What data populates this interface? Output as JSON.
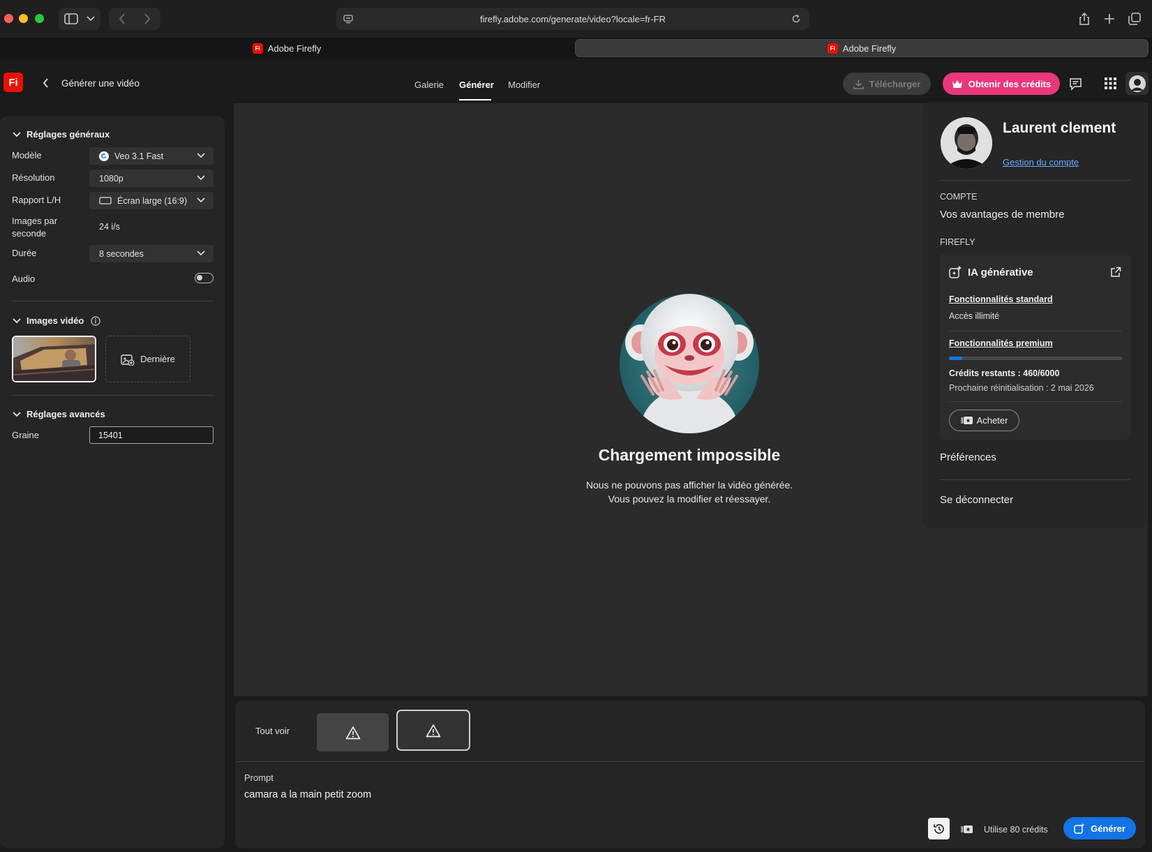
{
  "browser": {
    "url": "firefly.adobe.com/generate/video?locale=fr-FR",
    "tabs": [
      {
        "label": "Adobe Firefly",
        "favicon": "Fi"
      },
      {
        "label": "Adobe Firefly",
        "favicon": "Fi"
      }
    ]
  },
  "header": {
    "logo": "Fi",
    "back_title": "Générer une vidéo",
    "nav": [
      "Galerie",
      "Générer",
      "Modifier"
    ],
    "active_nav": "Générer",
    "download_label": "Télécharger",
    "credits_button": "Obtenir des crédits"
  },
  "settings": {
    "general_title": "Réglages généraux",
    "rows": {
      "model_label": "Modèle",
      "model_value": "Veo 3.1 Fast",
      "resolution_label": "Résolution",
      "resolution_value": "1080p",
      "ratio_label": "Rapport L/H",
      "ratio_value": "Écran large (16:9)",
      "fps_label_1": "Images par",
      "fps_label_2": "seconde",
      "fps_value": "24 i/s",
      "duration_label": "Durée",
      "duration_value": "8 secondes",
      "audio_label": "Audio"
    },
    "audio_on": false,
    "video_images_title": "Images vidéo",
    "last_label": "Dernière",
    "advanced_title": "Réglages avancés",
    "seed_label": "Graine",
    "seed_value": "15401"
  },
  "main": {
    "error_title": "Chargement impossible",
    "error_line1": "Nous ne pouvons pas afficher la vidéo générée.",
    "error_line2": "Vous pouvez la modifier et réessayer."
  },
  "bottom": {
    "see_all": "Tout voir",
    "prompt_label": "Prompt",
    "prompt_text": "camara a la main petit zoom",
    "credits_usage": "Utilise 80 crédits",
    "generate_label": "Générer"
  },
  "profile": {
    "name": "Laurent clement",
    "account_link": "Gestion du compte",
    "section_account": "COMPTE",
    "member_benefits": "Vos avantages de membre",
    "section_firefly": "FIREFLY",
    "genai_title": "IA générative",
    "standard_link": "Fonctionnalités standard",
    "standard_access": "Accès illimité",
    "premium_link": "Fonctionnalités premium",
    "credits_fraction": 0.077,
    "credits_text": "Crédits restants : 460/6000",
    "reset_text": "Prochaine réinitialisation : 2 mai 2026",
    "buy_label": "Acheter",
    "preferences": "Préférences",
    "logout": "Se déconnecter"
  },
  "colors": {
    "accent_blue": "#1473e6",
    "credits_pink": "#e9377a",
    "brand_red": "#eb1000"
  }
}
